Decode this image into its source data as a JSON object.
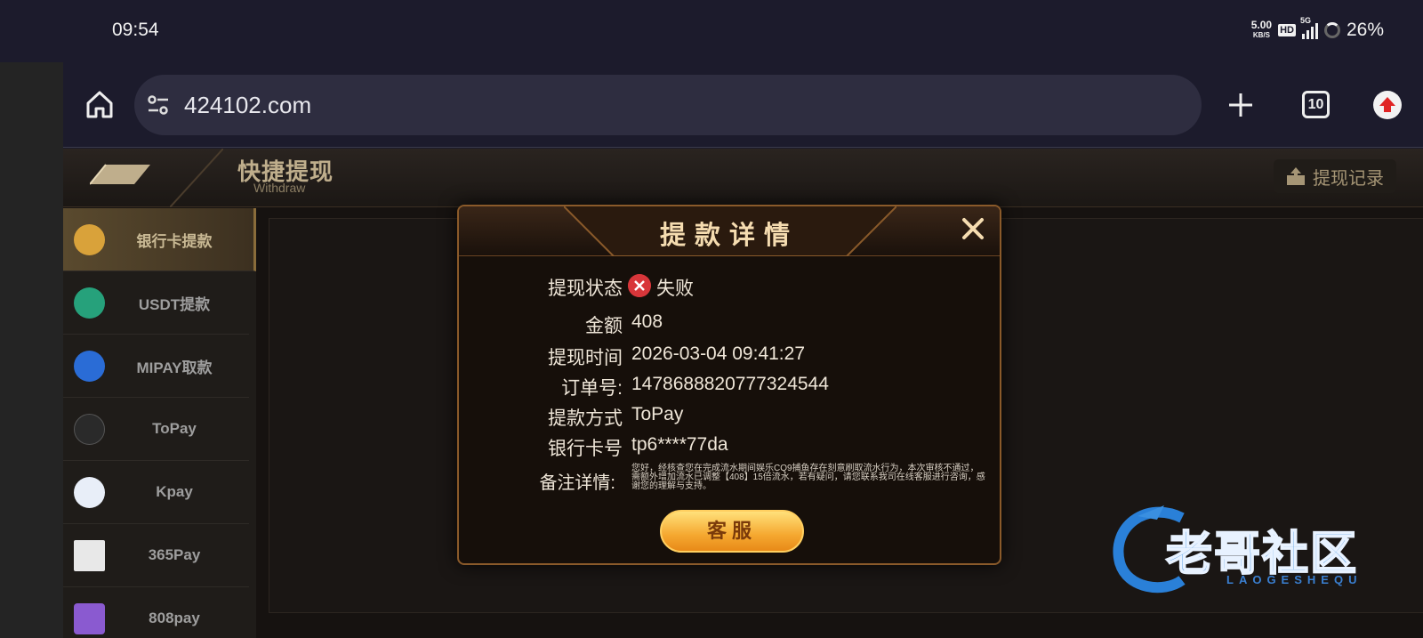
{
  "status_bar": {
    "time": "09:54",
    "net_speed": "5.00",
    "net_unit": "KB/S",
    "hd": "HD",
    "network": "5G",
    "battery": "26%"
  },
  "browser": {
    "url": "424102.com",
    "tab_count": "10"
  },
  "page": {
    "title": "快捷提现",
    "subtitle": "Withdraw",
    "record_label": "提现记录"
  },
  "sidebar": {
    "items": [
      {
        "label": "银行卡提款",
        "icon": "bank-card-icon",
        "color": "#d9a23a",
        "active": true
      },
      {
        "label": "USDT提款",
        "icon": "tether-icon",
        "color": "#26a17b"
      },
      {
        "label": "MIPAY取款",
        "icon": "mipay-icon",
        "color": "#2a6cd6"
      },
      {
        "label": "ToPay",
        "icon": "topay-icon",
        "color": "#2a2a2a"
      },
      {
        "label": "Kpay",
        "icon": "kpay-icon",
        "color": "#e8eef8"
      },
      {
        "label": "365Pay",
        "icon": "365pay-icon",
        "color": "#e8e8e8"
      },
      {
        "label": "808pay",
        "icon": "808pay-icon",
        "color": "#8a5ad0"
      }
    ]
  },
  "modal": {
    "title": "提款详情",
    "status_label": "提现状态",
    "status_value": "失败",
    "amount_label": "金额",
    "amount_value": "408",
    "time_label": "提现时间",
    "time_value": "2026-03-04 09:41:27",
    "order_label": "订单号:",
    "order_value": "1478688820777324544",
    "method_label": "提款方式",
    "method_value": "ToPay",
    "card_label": "银行卡号",
    "card_value": "tp6****77da",
    "note_label": "备注详情:",
    "note_value": "您好，经核查您在完成流水期间娱乐CQ9捕鱼存在刻意刷取流水行为，本次审核不通过，需额外增加流水已调整【408】15倍流水，若有疑问，请您联系我司在线客服进行咨询，感谢您的理解与支持。",
    "cs_button": "客服"
  },
  "watermark": {
    "text": "老哥社区",
    "sub": "LAOGESHEQU"
  }
}
